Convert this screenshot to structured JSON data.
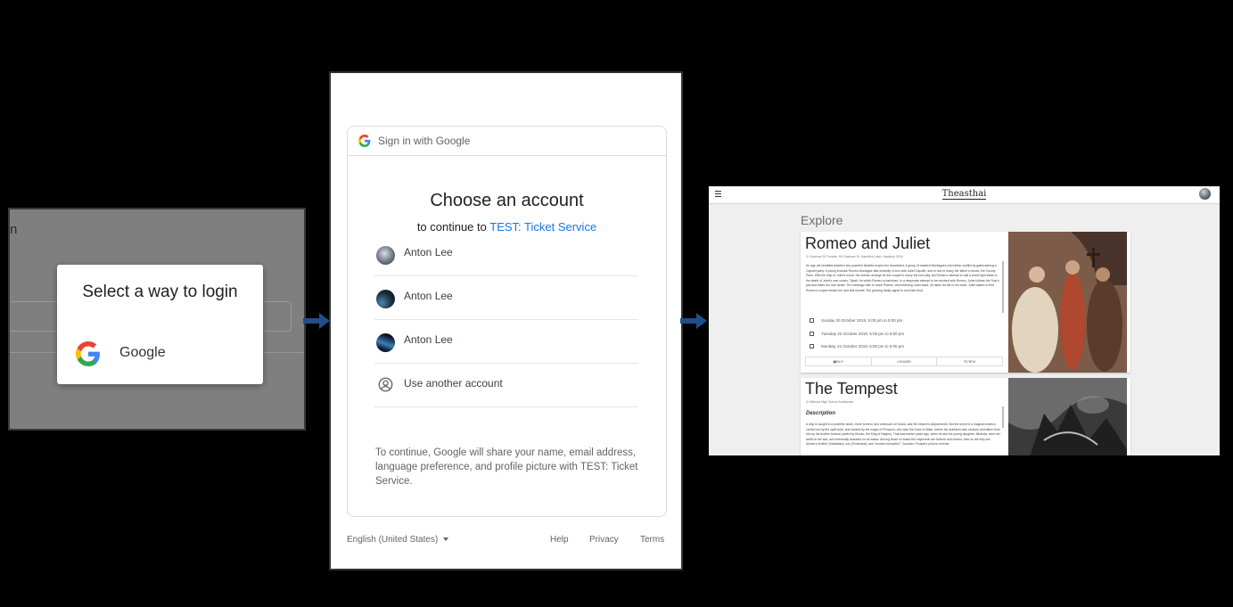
{
  "login_panel": {
    "stray_text": "n",
    "dialog_title": "Select a way to login",
    "google_option_label": "Google"
  },
  "google_chooser": {
    "header": "Sign in with Google",
    "title": "Choose an account",
    "subtitle_prefix": "to continue to ",
    "app_name": "TEST: Ticket Service",
    "accounts": [
      {
        "name": "Anton Lee"
      },
      {
        "name": "Anton Lee"
      },
      {
        "name": "Anton Lee"
      }
    ],
    "use_another": "Use another account",
    "disclaimer": "To continue, Google will share your name, email address, language preference, and profile picture with TEST: Ticket Service.",
    "language": "English (United States)",
    "footer_links": [
      "Help",
      "Privacy",
      "Terms"
    ]
  },
  "theasthai_app": {
    "logo": "Theasthai",
    "page_title": "Explore",
    "shows": [
      {
        "title": "Romeo and Juliet",
        "venue": "Clarence St Theatre, 59 Clarence St, Hamilton Lake, Hamilton 3204",
        "description": "An age old vendetta between two powerful families erupts into bloodshed. A group of masked Montagues risk further conflict by gatecrashing a Capulet party. A young lovesick Romeo Montague falls instantly in love with Juliet Capulet, who is due to marry her father's choice, the County Paris. With the help of Juliet's nurse, the women arrange for the couple to marry the next day, but Romeo's attempt to halt a street fight leads to the death of Juliet's own cousin, Tybalt, for which Romeo is banished. In a desperate attempt to be reunited with Romeo, Juliet follows the Friar's plot and fakes her own death. The message fails to reach Romeo, and believing Juliet dead, he takes his life in her tomb. Juliet wakes to find Romeo's corpse beside her and kills herself. The grieving family agree to end their feud.",
        "dates": [
          "Sunday 20 October 2019, 5:00 pm to 5:00 pm",
          "Tuesday 22 October 2019, 5:00 pm to 5:00 pm",
          "Monday, 21 October 2019, 5:00 pm to 5:00 pm"
        ],
        "actions": [
          "BUY",
          "SHARE",
          "VIEW"
        ]
      },
      {
        "title": "The Tempest",
        "venue": "Hillcrest High School Auditorium",
        "description_heading": "Description",
        "description": "A ship is caught in a powerful storm, there is terror and confusion on board, and the vessel is shipwrecked. But the storm is a magical creation carried out by the spirit Ariel, and caused by the magic of Prospero, who was the Duke of Milan, before his dukedom was usurped and taken from him by his brother Antonio (aided by Alonso, the King of Naples). That was twelve years ago, when he and his young daughter, Miranda, were set adrift on the sea, and eventually stranded on an island. Among those on board the shipwreck are Antonio and Alonso. Also on the ship are Alonso's brother (Sebastian), son (Ferdinand), and \"trusted counsellor\", Gonzalo. Prospero plots to reverse"
      }
    ]
  }
}
